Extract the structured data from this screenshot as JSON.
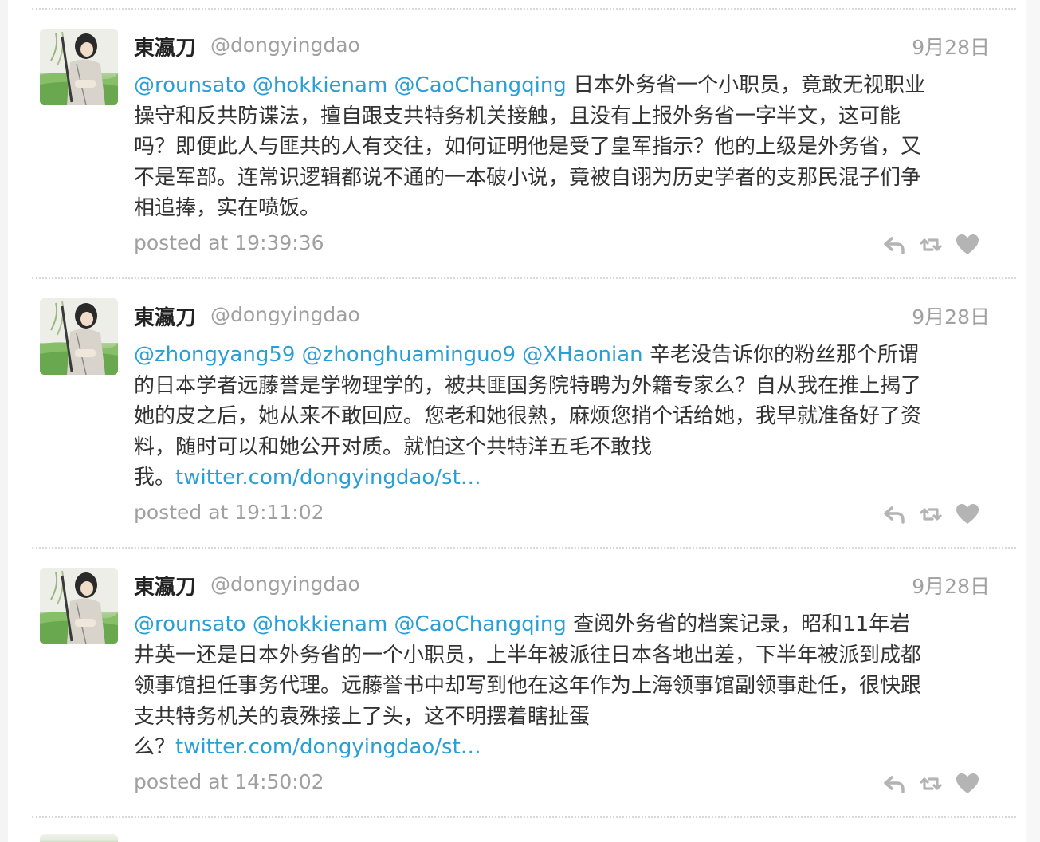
{
  "tweets": [
    {
      "name": "東瀛刀",
      "handle": "@dongyingdao",
      "date": "9月28日",
      "lines": [
        [
          {
            "text": "@rounsato @hokkienam @CaoChangqing",
            "link": true
          },
          {
            "text": " 日本外务省一个小职员，竟敢无视职业",
            "link": false
          }
        ],
        [
          {
            "text": "操守和反共防谍法，擅自跟支共特务机关接触，且没有上报外务省一字半文，这可能",
            "link": false
          }
        ],
        [
          {
            "text": "吗？即便此人与匪共的人有交往，如何证明他是受了皇军指示？他的上级是外务省，又",
            "link": false
          }
        ],
        [
          {
            "text": "不是军部。连常识逻辑都说不通的一本破小说，竟被自诩为历史学者的支那民混子们争",
            "link": false
          }
        ],
        [
          {
            "text": "相追捧，实在喷饭。",
            "link": false
          }
        ]
      ],
      "posted": "posted at 19:39:36"
    },
    {
      "name": "東瀛刀",
      "handle": "@dongyingdao",
      "date": "9月28日",
      "lines": [
        [
          {
            "text": "@zhongyang59 @zhonghuaminguo9 @XHaonian",
            "link": true
          },
          {
            "text": " 辛老没告诉你的粉丝那个所谓",
            "link": false
          }
        ],
        [
          {
            "text": "的日本学者远藤誉是学物理学的，被共匪国务院特聘为外籍专家么？自从我在推上揭了",
            "link": false
          }
        ],
        [
          {
            "text": "她的皮之后，她从来不敢回应。您老和她很熟，麻烦您捎个话给她，我早就准备好了资",
            "link": false
          }
        ],
        [
          {
            "text": "料，随时可以和她公开对质。就怕这个共特洋五毛不敢找",
            "link": false
          }
        ],
        [
          {
            "text": "我。",
            "link": false
          },
          {
            "text": "twitter.com/dongyingdao/st…",
            "link": true
          }
        ]
      ],
      "posted": "posted at 19:11:02"
    },
    {
      "name": "東瀛刀",
      "handle": "@dongyingdao",
      "date": "9月28日",
      "lines": [
        [
          {
            "text": "@rounsato @hokkienam @CaoChangqing",
            "link": true
          },
          {
            "text": " 查阅外务省的档案记录，昭和11年岩",
            "link": false
          }
        ],
        [
          {
            "text": "井英一还是日本外务省的一个小职员，上半年被派往日本各地出差，下半年被派到成都",
            "link": false
          }
        ],
        [
          {
            "text": "领事馆担任事务代理。远藤誉书中却写到他在这年作为上海领事馆副领事赴任，很快跟",
            "link": false
          }
        ],
        [
          {
            "text": "支共特务机关的袁殊接上了头，这不明摆着瞎扯蛋",
            "link": false
          }
        ],
        [
          {
            "text": "么？",
            "link": false
          },
          {
            "text": "twitter.com/dongyingdao/st…",
            "link": true
          }
        ]
      ],
      "posted": "posted at 14:50:02"
    }
  ],
  "colors": {
    "link": "#2a9fd6",
    "muted": "#a0a0a0",
    "text": "#333333",
    "icon": "#b4b4b4",
    "divider": "#d9d9d9"
  },
  "icons": [
    "avatar",
    "reply-icon",
    "retweet-icon",
    "favorite-icon"
  ]
}
